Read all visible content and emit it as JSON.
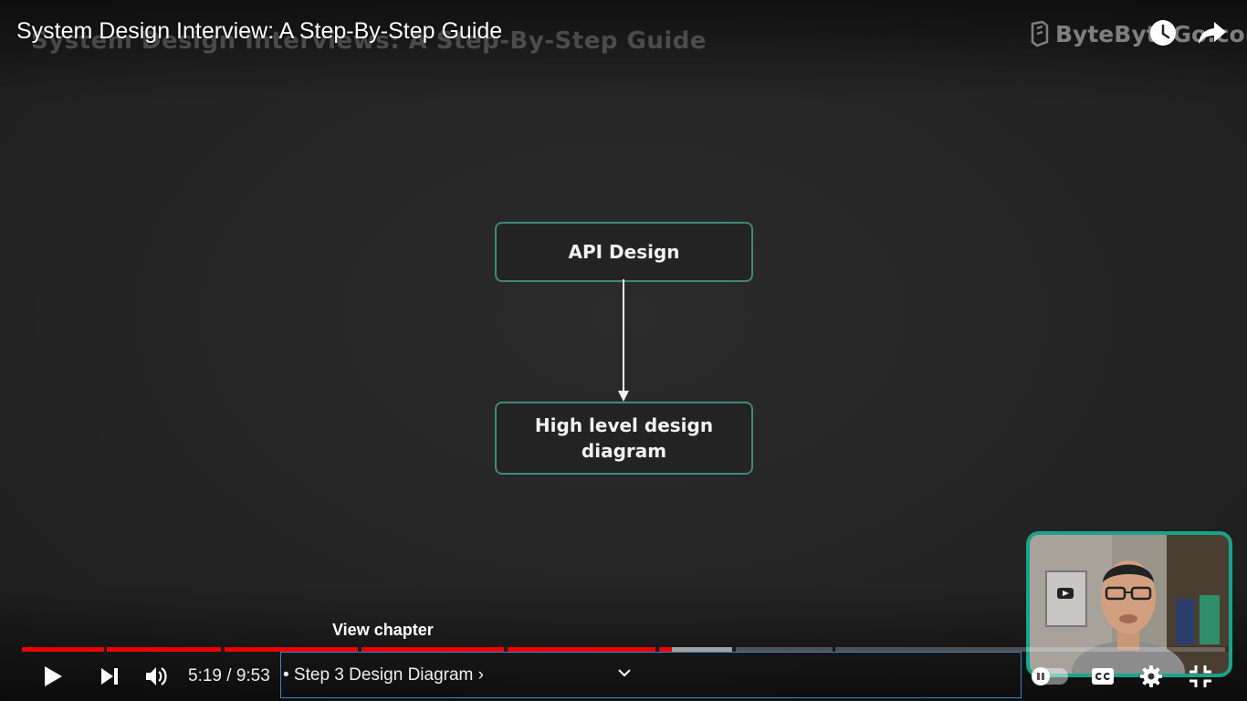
{
  "video": {
    "title": "System Design Interview: A Step-By-Step Guide",
    "slide_title": "System Design Interviews: A Step-By-Step Guide",
    "brand": "ByteByteGo.com"
  },
  "diagram": {
    "box1_label": "API Design",
    "box2_label_line1": "High level design",
    "box2_label_line2": "diagram"
  },
  "top_icons": [
    "clock-icon",
    "share-icon"
  ],
  "controls": {
    "view_chapter_tooltip": "View chapter",
    "current_time": "5:19",
    "separator": "/",
    "duration": "9:53",
    "chapter_label": "• Step 3 Design Diagram ›",
    "played_fraction": 0.54,
    "icons": [
      "play-icon",
      "next-icon",
      "volume-icon",
      "chevron-down-icon",
      "autoplay-toggle",
      "captions-icon",
      "settings-icon",
      "exit-fullscreen-icon"
    ]
  },
  "colors": {
    "progress_played": "#ee0000",
    "pip_border": "#19a38b",
    "diagram_border": "#3f8a78",
    "chapter_outline": "#3b86c8"
  }
}
